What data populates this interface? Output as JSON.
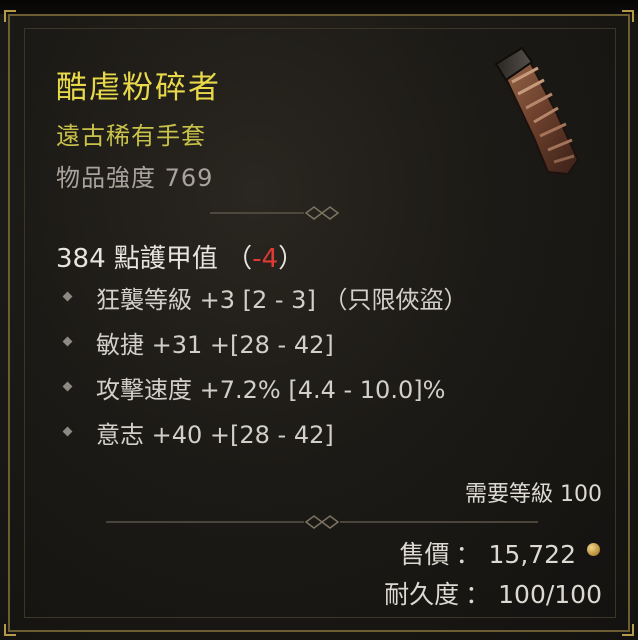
{
  "item": {
    "name": "酷虐粉碎者",
    "type": "遠古稀有手套",
    "power": "物品強度 769"
  },
  "armor": {
    "value_text": "384 點護甲值",
    "open_paren": "（",
    "delta": "-4",
    "close_paren": "）"
  },
  "affixes": [
    {
      "text": "狂襲等級 +3 [2 - 3] （只限俠盜）"
    },
    {
      "text": "敏捷 +31 +[28 - 42]"
    },
    {
      "text": "攻擊速度 +7.2% [4.4 - 10.0]%"
    },
    {
      "text": "意志 +40 +[28 - 42]"
    }
  ],
  "requirements": {
    "level_text": "需要等級 100"
  },
  "price": {
    "label": "售價",
    "colon": "：",
    "value": "15,722"
  },
  "durability": {
    "label": "耐久度",
    "colon": "：",
    "value": "100/100"
  },
  "colors": {
    "name": "#e8d94a",
    "type": "#c9c24a",
    "delta_negative": "#e03a32",
    "frame": "#6b5e33"
  },
  "icons": {
    "item": "gloves-icon",
    "currency": "gold-coin-icon"
  }
}
